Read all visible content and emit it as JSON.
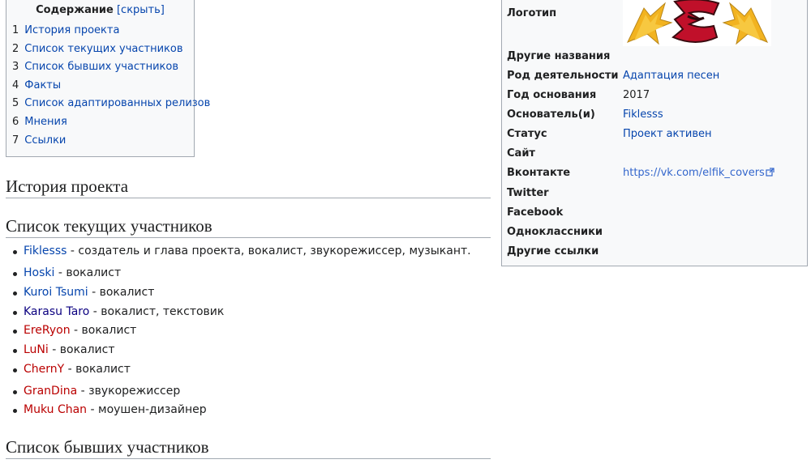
{
  "toc": {
    "title": "Содержание",
    "toggle": "[скрыть]",
    "items": [
      {
        "num": "1",
        "label": "История проекта"
      },
      {
        "num": "2",
        "label": "Список текущих участников"
      },
      {
        "num": "3",
        "label": "Список бывших участников"
      },
      {
        "num": "4",
        "label": "Факты"
      },
      {
        "num": "5",
        "label": "Список адаптированных релизов"
      },
      {
        "num": "6",
        "label": "Мнения"
      },
      {
        "num": "7",
        "label": "Ссылки"
      }
    ]
  },
  "headings": {
    "history": "История проекта",
    "current": "Список текущих участников",
    "former": "Список бывших участников"
  },
  "members": [
    {
      "name": "Fiklesss",
      "role": " - создатель и глава проекта, вокалист, звукорежиссер, музыкант.",
      "link": "blue"
    },
    {
      "name": "Hoski",
      "role": " - вокалист",
      "link": "blue"
    },
    {
      "name": "Kuroi Tsumi",
      "role": " - вокалист",
      "link": "blue"
    },
    {
      "name": "Karasu Taro",
      "role": " - вокалист, текстовик",
      "link": "dark"
    },
    {
      "name": "EreRyon",
      "role": " - вокалист",
      "link": "red"
    },
    {
      "name": "LuNi",
      "role": " - вокалист",
      "link": "red"
    },
    {
      "name": "ChernY",
      "role": " - вокалист",
      "link": "red"
    },
    {
      "name": "GranDina",
      "role": " - звукорежиссер",
      "link": "red"
    },
    {
      "name": "Muku Chan",
      "role": " - моушен-дизайнер",
      "link": "red"
    }
  ],
  "infobox": {
    "logo_label": "Логотип",
    "rows": [
      {
        "label": "Другие названия",
        "value": ""
      },
      {
        "label": "Род деятельности",
        "value": "Адаптация песен"
      },
      {
        "label": "Год основания",
        "value": "2017"
      },
      {
        "label": "Основатель(и)",
        "value": "Fiklesss"
      },
      {
        "label": "Статус",
        "value": "Проект активен"
      },
      {
        "label": "Сайт",
        "value": ""
      },
      {
        "label": "Вконтакте",
        "value": "https://vk.com/elfik_covers"
      },
      {
        "label": "Twitter",
        "value": ""
      },
      {
        "label": "Facebook",
        "value": ""
      },
      {
        "label": "Одноклассники",
        "value": ""
      },
      {
        "label": "Другие ссылки",
        "value": ""
      }
    ]
  },
  "colors": {
    "link": "#0645ad",
    "visited_link": "#0b0080",
    "missing_link": "#ba0000",
    "logo_red": "#c0102a",
    "logo_gold": "#f2b320"
  }
}
